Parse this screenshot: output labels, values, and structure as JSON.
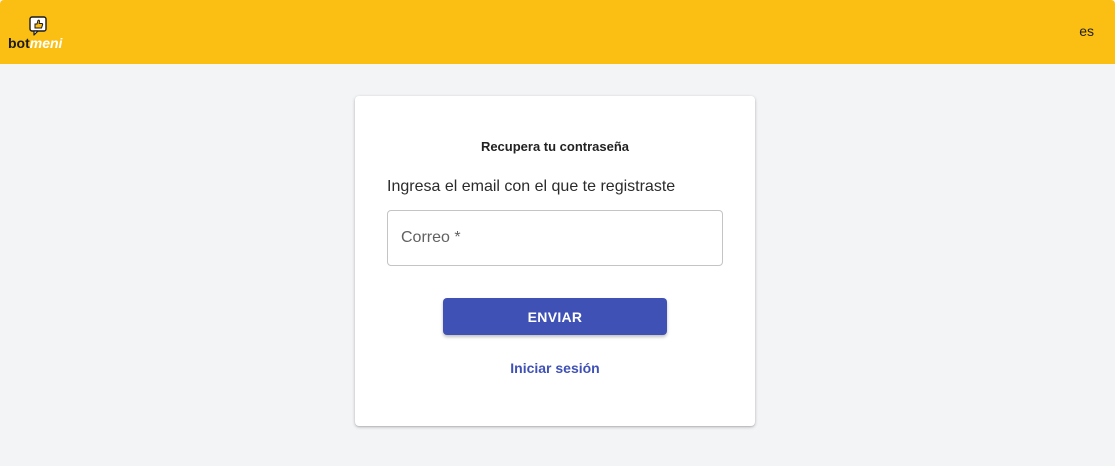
{
  "header": {
    "logo_text_bot": "bot",
    "logo_text_meni": "meni",
    "logo_icon": "thumbs-up-speech-bubble-icon",
    "language": "es",
    "background_color": "#fbbf14"
  },
  "recover": {
    "title": "Recupera tu contraseña",
    "subtitle": "Ingresa el email con el que te registraste",
    "email_field": {
      "placeholder": "Correo *",
      "value": ""
    },
    "submit_label": "ENVIAR",
    "login_link": "Iniciar sesión",
    "accent_color": "#3f51b5"
  }
}
